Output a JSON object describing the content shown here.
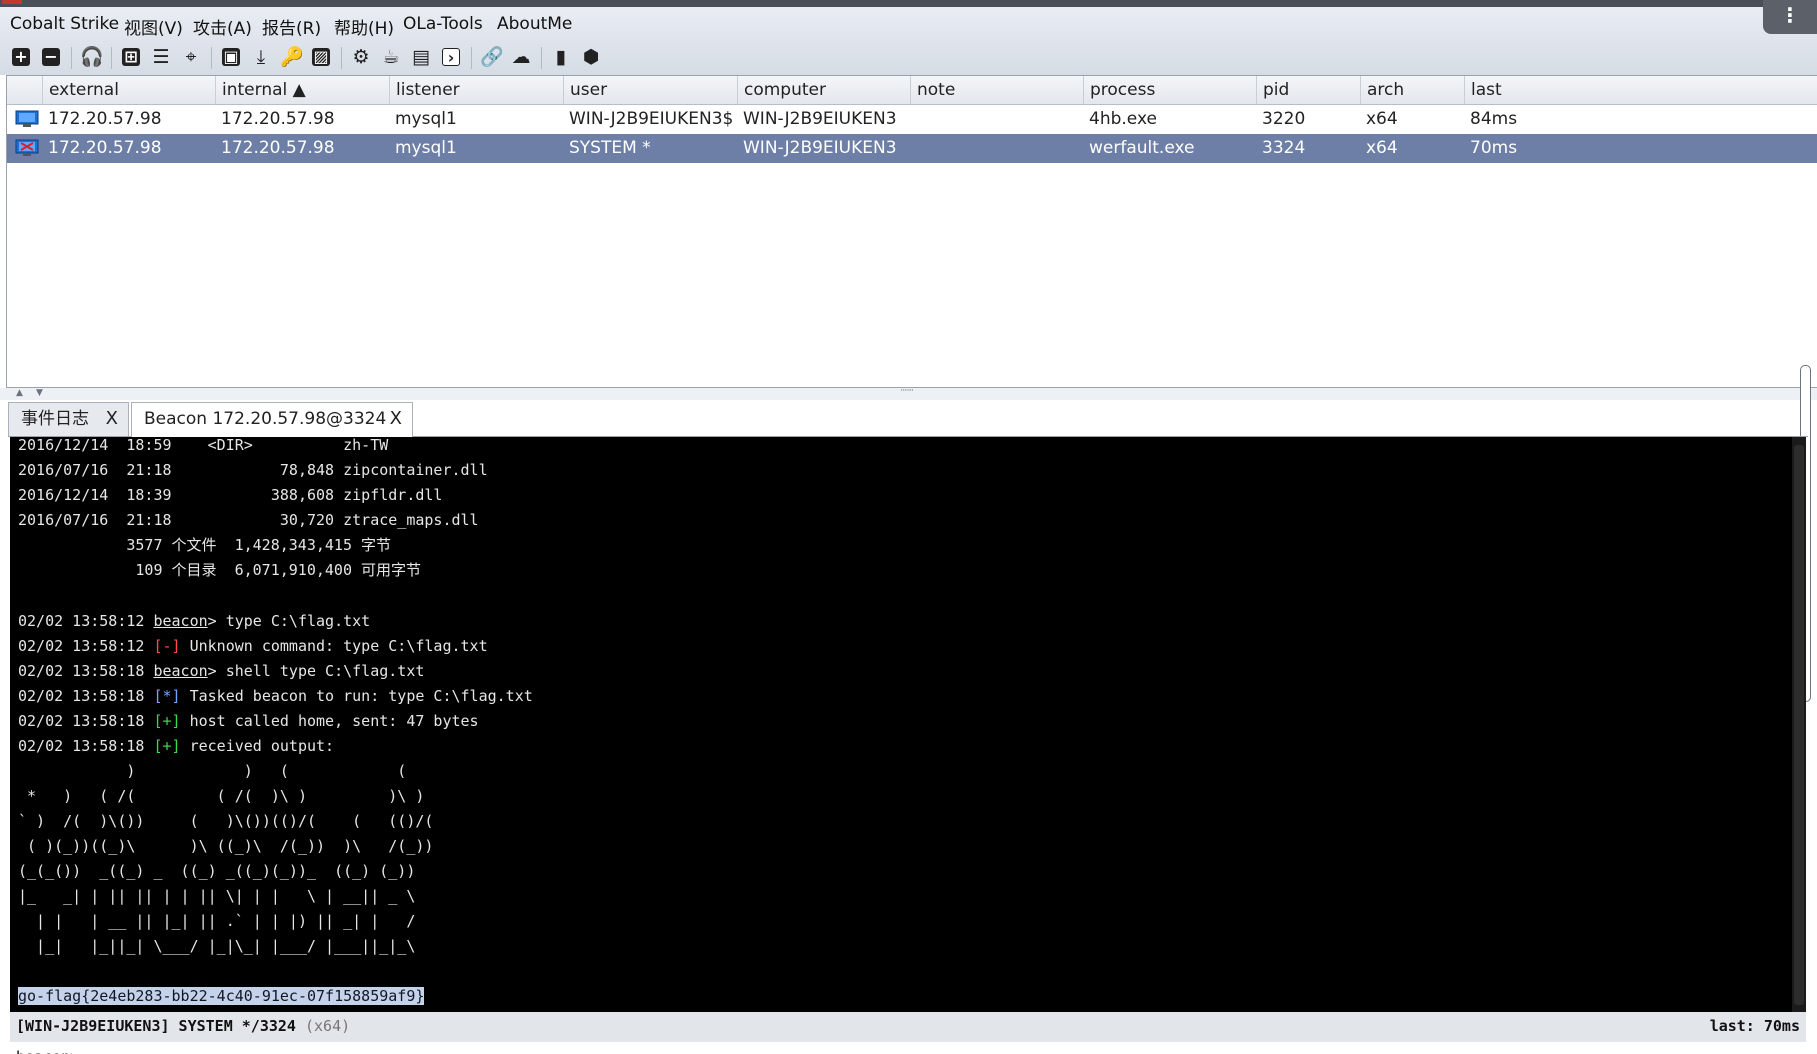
{
  "app": {
    "menu": [
      "Cobalt Strike",
      "视图(V)",
      "攻击(A)",
      "报告(R)",
      "帮助(H)",
      "OLa-Tools",
      "AboutMe"
    ],
    "toolbar_icons": [
      "new-connection-icon",
      "disconnect-icon",
      "headphones-icon",
      "graph-view-icon",
      "list-view-icon",
      "target-icon",
      "credentials-icon",
      "download-icon",
      "key-icon",
      "screenshot-icon",
      "settings-icon",
      "coffee-icon",
      "document-icon",
      "console-icon",
      "link-icon",
      "cloud-icon",
      "book-icon",
      "package-icon"
    ]
  },
  "sessions": {
    "columns": [
      "external",
      "internal ▲",
      "listener",
      "user",
      "computer",
      "note",
      "process",
      "pid",
      "arch",
      "last"
    ],
    "rows": [
      {
        "external": "172.20.57.98",
        "internal": "172.20.57.98",
        "listener": "mysql1",
        "user": "WIN-J2B9EIUKEN3$",
        "computer": "WIN-J2B9EIUKEN3",
        "note": "",
        "process": "4hb.exe",
        "pid": "3220",
        "arch": "x64",
        "last": "84ms"
      },
      {
        "external": "172.20.57.98",
        "internal": "172.20.57.98",
        "listener": "mysql1",
        "user": "SYSTEM *",
        "computer": "WIN-J2B9EIUKEN3",
        "note": "",
        "process": "werfault.exe",
        "pid": "3324",
        "arch": "x64",
        "last": "70ms"
      }
    ]
  },
  "tabs": [
    {
      "label": "事件日志",
      "close": "X"
    },
    {
      "label": "Beacon 172.20.57.98@3324",
      "close": "X"
    }
  ],
  "console": {
    "dir1": "2016/12/14  18:59    <DIR>          zh-TW",
    "dir2": "2016/07/16  21:18            78,848 zipcontainer.dll",
    "dir3": "2016/12/14  18:39           388,608 zipfldr.dll",
    "dir4": "2016/07/16  21:18            30,720 ztrace_maps.dll",
    "dir5": "            3577 个文件  1,428,343,415 字节",
    "dir6": "             109 个目录  6,071,910,400 可用字节",
    "l1_ts": "02/02 13:58:12 ",
    "l1_beacon": "beacon",
    "l1_rest": "> type C:\\flag.txt",
    "l2_ts": "02/02 13:58:12 ",
    "l2_tag": "[-]",
    "l2_rest": " Unknown command: type C:\\flag.txt",
    "l3_ts": "02/02 13:58:18 ",
    "l3_beacon": "beacon",
    "l3_rest": "> shell type C:\\flag.txt",
    "l4_ts": "02/02 13:58:18 ",
    "l4_tag": "[*]",
    "l4_rest": " Tasked beacon to run: type C:\\flag.txt",
    "l5_ts": "02/02 13:58:18 ",
    "l5_tag": "[+]",
    "l5_rest": " host called home, sent: 47 bytes",
    "l6_ts": "02/02 13:58:18 ",
    "l6_tag": "[+]",
    "l6_rest": " received output:",
    "art1": "            )            )   (            (",
    "art2": " *   )   ( /(         ( /(  )\\ )         )\\ )",
    "art3": "` )  /(  )\\())     (   )\\())(()/(    (   (()/(",
    "art4": " ( )(_))((_)\\      )\\ ((_)\\  /(_))  )\\   /(_))",
    "art5": "(_(_())  _((_) _  ((_) _((_)(_))_  ((_) (_))",
    "art6": "|_   _| | || || | | || \\| | |   \\ | __|| _ \\",
    "art7": "  | |   | __ || |_| || .` | | |) || _| |   /",
    "art8": "  |_|   |_||_| \\___/ |_|\\_| |___/ |___||_|_\\",
    "flag": "go-flag{2e4eb283-bb22-4c40-91ec-07f158859af9}"
  },
  "status": {
    "left": "[WIN-J2B9EIUKEN3] SYSTEM */3324",
    "arch": "(x64)",
    "right": "last: 70ms"
  },
  "prompt": "beacon>"
}
